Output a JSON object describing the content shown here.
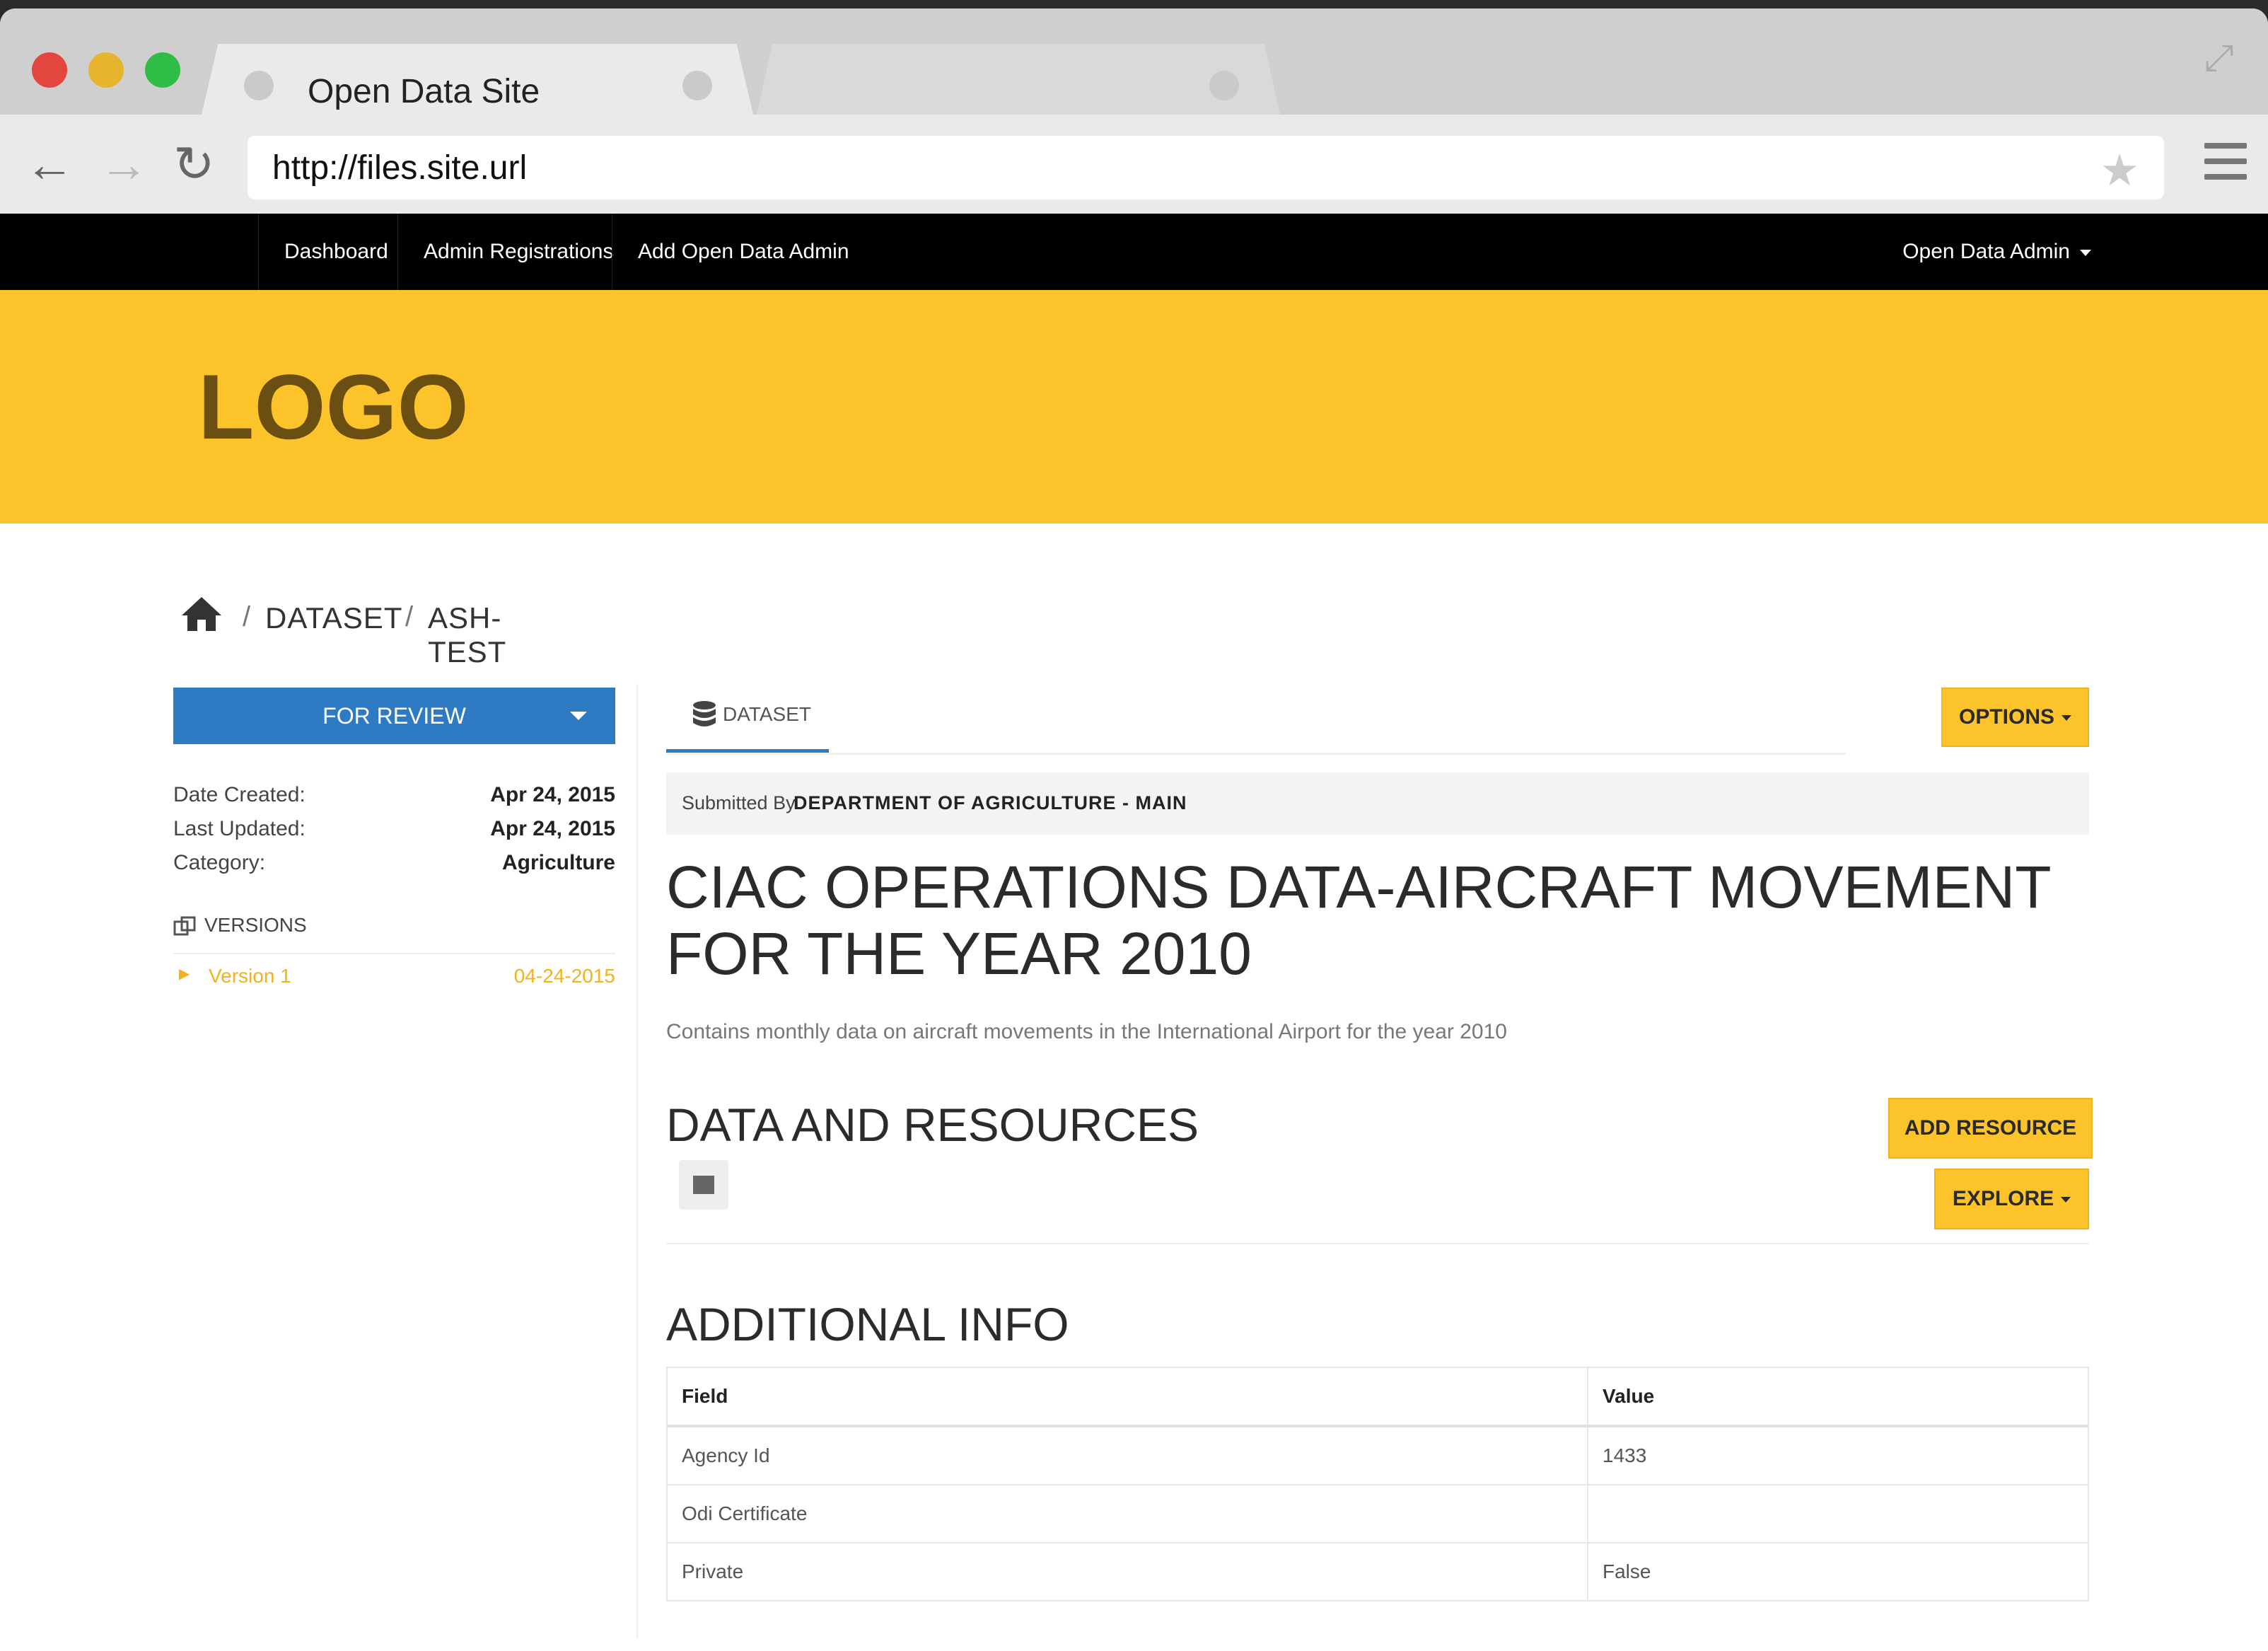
{
  "browser": {
    "tab_title": "Open Data Site",
    "url": "http://files.site.url"
  },
  "topnav": {
    "items": [
      "Dashboard",
      "Admin Registrations",
      "Add Open Data Admin"
    ],
    "user_menu": "Open Data Admin"
  },
  "banner": {
    "logo": "LOGO"
  },
  "breadcrumb": {
    "items": [
      "DATASET",
      "ASH-TEST"
    ],
    "separator": "/"
  },
  "sidebar": {
    "status_button": "FOR REVIEW",
    "meta": [
      {
        "label": "Date Created:",
        "value": "Apr 24, 2015"
      },
      {
        "label": "Last Updated:",
        "value": "Apr 24, 2015"
      },
      {
        "label": "Category:",
        "value": "Agriculture"
      }
    ],
    "versions_heading": "VERSIONS",
    "versions": [
      {
        "name": "Version 1",
        "date": "04-24-2015"
      }
    ]
  },
  "main": {
    "tab_label": "DATASET",
    "options_button": "OPTIONS",
    "submitted_prefix": "Submitted By",
    "submitted_by": "DEPARTMENT OF AGRICULTURE - MAIN",
    "title": "CIAC OPERATIONS DATA-AIRCRAFT MOVEMENT FOR THE YEAR 2010",
    "description": "Contains monthly data on aircraft movements in the International Airport for the year 2010",
    "resources_heading": "DATA AND RESOURCES",
    "add_resource_button": "ADD RESOURCE",
    "explore_button": "EXPLORE",
    "additional_info_heading": "ADDITIONAL INFO",
    "table": {
      "headers": [
        "Field",
        "Value"
      ],
      "rows": [
        [
          "Agency Id",
          "1433"
        ],
        [
          "Odi Certificate",
          ""
        ],
        [
          "Private",
          "False"
        ]
      ]
    }
  },
  "colors": {
    "accent_yellow": "#fcc42a",
    "primary_blue": "#2e7bc4",
    "version_orange": "#f2b21c",
    "nav_black": "#000000"
  }
}
